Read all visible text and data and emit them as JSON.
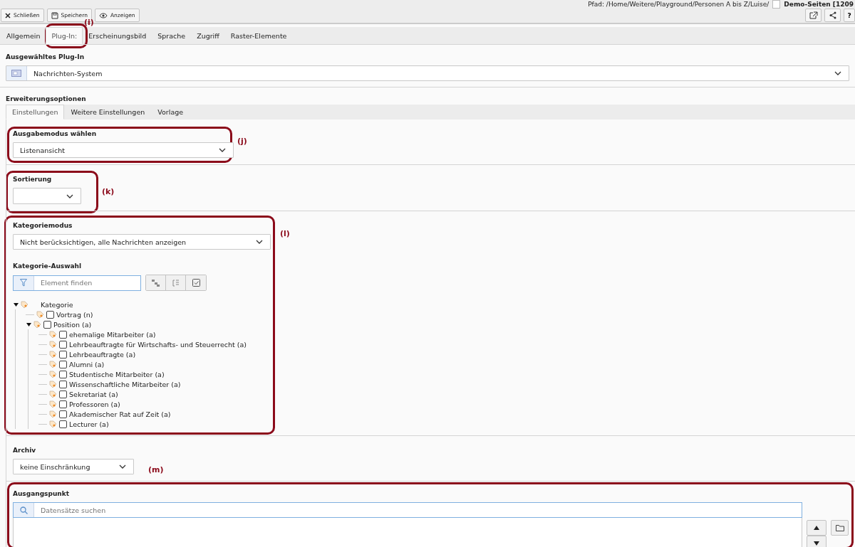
{
  "header": {
    "path": "Pfad: /Home/Weitere/Playground/Personen A bis Z/Luise/",
    "page_title": "Demo-Seiten [1209"
  },
  "toolbar": {
    "buttons": [
      {
        "kind": "close",
        "label": "Schließen"
      },
      {
        "kind": "save",
        "label": "Speichern"
      },
      {
        "kind": "view",
        "label": "Anzeigen"
      }
    ],
    "right_buttons": [
      {
        "kind": "open"
      },
      {
        "kind": "share"
      },
      {
        "kind": "help",
        "label": "?"
      }
    ]
  },
  "tabs": [
    {
      "label": "Allgemein",
      "selected": false
    },
    {
      "label": "Plug-In:",
      "selected": true
    },
    {
      "label": "Erscheinungsbild",
      "selected": false
    },
    {
      "label": "Sprache",
      "selected": false
    },
    {
      "label": "Zugriff",
      "selected": false
    },
    {
      "label": "Raster-Elemente",
      "selected": false
    }
  ],
  "plugin": {
    "label": "Ausgewähltes Plug-In",
    "value": "Nachrichten-System"
  },
  "extension": {
    "title": "Erweiterungsoptionen",
    "subtabs": [
      {
        "label": "Einstellungen",
        "selected": true
      },
      {
        "label": "Weitere Einstellungen",
        "selected": false
      },
      {
        "label": "Vorlage",
        "selected": false
      }
    ]
  },
  "output_mode": {
    "label": "Ausgabemodus wählen",
    "value": "Listenansicht"
  },
  "sorting": {
    "label": "Sortierung"
  },
  "category_mode": {
    "label": "Kategoriemodus",
    "value": "Nicht berücksichtigen, alle Nachrichten anzeigen"
  },
  "category_selection": {
    "label": "Kategorie-Auswahl",
    "filter_placeholder": "Element finden",
    "tree": [
      {
        "label": "Kategorie",
        "root": true,
        "expanded": true,
        "children": [
          {
            "label": "Vortrag (n)",
            "checked": false
          },
          {
            "label": "Position (a)",
            "checked": false,
            "expanded": true,
            "children": [
              {
                "label": "ehemalige Mitarbeiter (a)",
                "checked": false
              },
              {
                "label": "Lehrbeauftragte für Wirtschafts- und Steuerrecht (a)",
                "checked": false
              },
              {
                "label": "Lehrbeauftragte (a)",
                "checked": false
              },
              {
                "label": "Alumni (a)",
                "checked": false
              },
              {
                "label": "Studentische Mitarbeiter (a)",
                "checked": false
              },
              {
                "label": "Wissenschaftliche Mitarbeiter (a)",
                "checked": false
              },
              {
                "label": "Sekretariat (a)",
                "checked": false
              },
              {
                "label": "Professoren (a)",
                "checked": false
              },
              {
                "label": "Akademischer Rat auf Zeit (a)",
                "checked": false
              },
              {
                "label": "Lecturer (a)",
                "checked": false
              }
            ]
          }
        ]
      }
    ]
  },
  "archive": {
    "label": "Archiv",
    "value": "keine Einschränkung"
  },
  "starting_point": {
    "label": "Ausgangspunkt",
    "search_placeholder": "Datensätze suchen"
  },
  "annotations": [
    {
      "label": "(i)"
    },
    {
      "label": "(j)"
    },
    {
      "label": "(k)"
    },
    {
      "label": "(l)"
    },
    {
      "label": "(m)"
    }
  ]
}
